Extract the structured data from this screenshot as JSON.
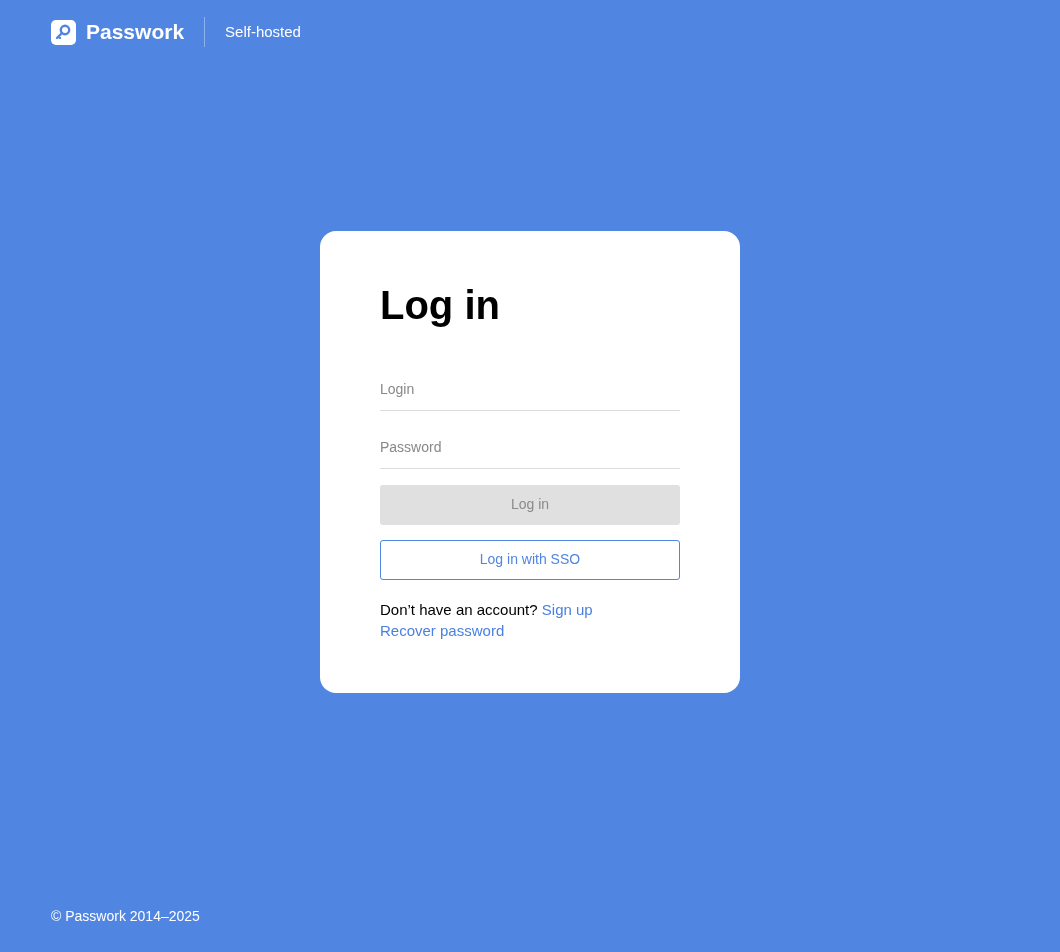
{
  "header": {
    "brand": "Passwork",
    "edition": "Self-hosted"
  },
  "form": {
    "title": "Log in",
    "fields": [
      {
        "placeholder": "Login"
      },
      {
        "placeholder": "Password"
      }
    ],
    "login_button": {
      "label": "Log in",
      "disabled": true
    },
    "sso_button": {
      "label": "Log in with SSO"
    },
    "signup": {
      "text": "Don’t have an account?",
      "link": "Sign up"
    },
    "recover_link": "Recover password"
  },
  "footer": {
    "copyright": "© Passwork 2014–2025"
  }
}
